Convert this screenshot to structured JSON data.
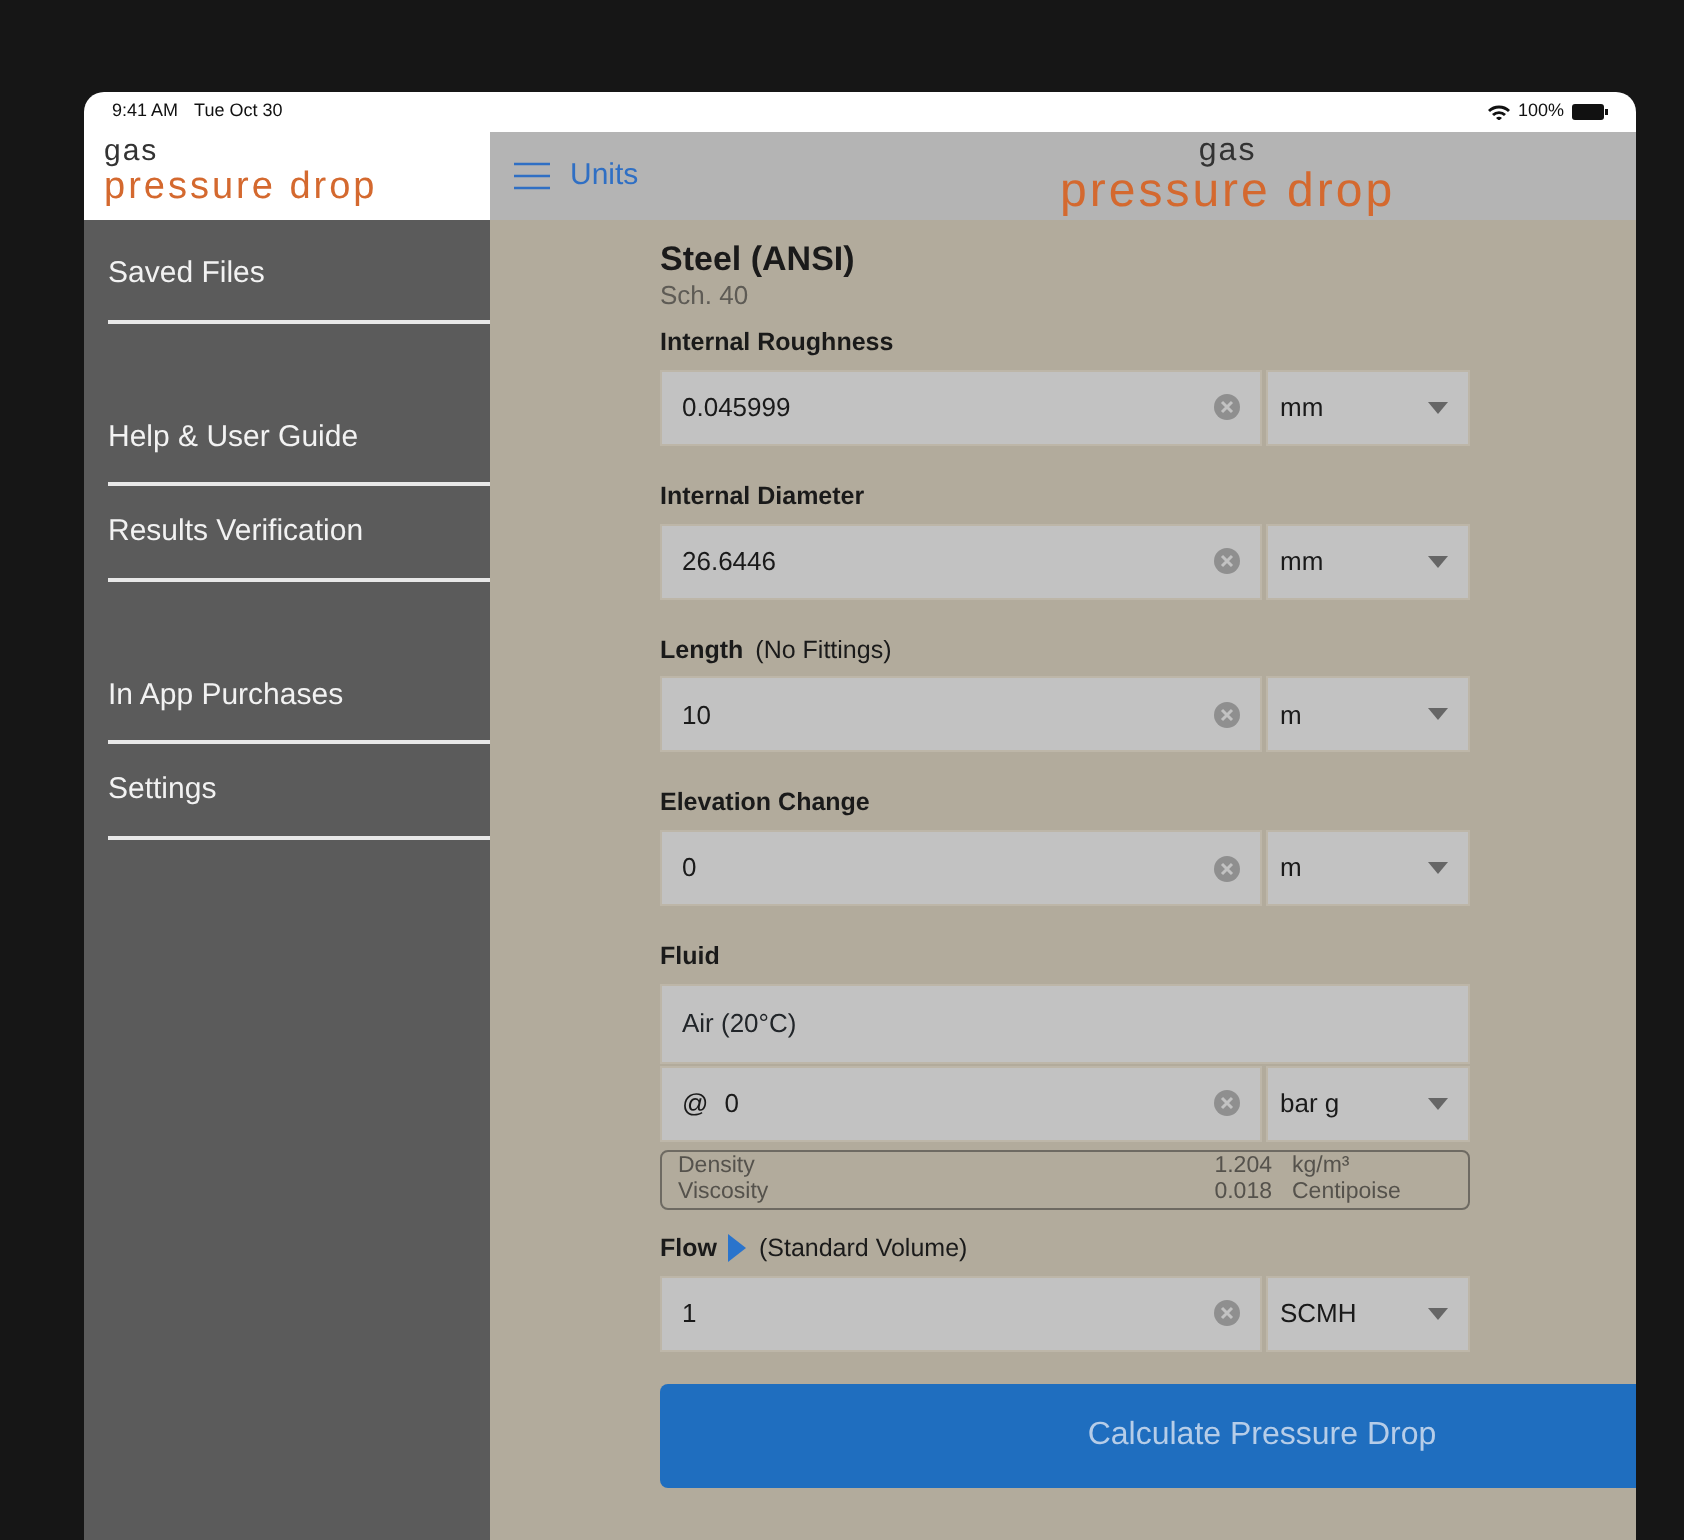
{
  "status_bar": {
    "time": "9:41 AM",
    "date": "Tue Oct 30",
    "battery": "100%"
  },
  "sidebar": {
    "logo": {
      "top": "gas",
      "bottom": "pressure drop"
    },
    "groups": [
      [
        "Saved Files"
      ],
      [
        "Help & User Guide",
        "Results Verification"
      ],
      [
        "In App Purchases",
        "Settings"
      ]
    ]
  },
  "header": {
    "menu_label": "Units",
    "logo": {
      "top": "gas",
      "bottom": "pressure drop"
    }
  },
  "form": {
    "material": {
      "title": "Steel (ANSI)",
      "schedule": "Sch.  40"
    },
    "fields": [
      {
        "kind": "measure",
        "label": "Internal Roughness",
        "value": "0.045999",
        "unit": "mm"
      },
      {
        "kind": "measure",
        "label": "Internal Diameter",
        "value": "26.6446",
        "unit": "mm"
      },
      {
        "kind": "measure",
        "label": "Length",
        "note": "(No Fittings)",
        "value": "10",
        "unit": "m"
      },
      {
        "kind": "measure",
        "label": "Elevation Change",
        "value": "0",
        "unit": "m"
      },
      {
        "kind": "fluid",
        "label": "Fluid",
        "fluid": "Air (20°C)",
        "prefix": "@",
        "value": "0",
        "unit": "bar g",
        "properties": [
          {
            "name": "Density",
            "value": "1.204",
            "unit": "kg/m³"
          },
          {
            "name": "Viscosity",
            "value": "0.018",
            "unit": "Centipoise"
          }
        ]
      },
      {
        "kind": "flow",
        "label": "Flow",
        "note": "(Standard Volume)",
        "value": "1",
        "unit": "SCMH"
      }
    ],
    "button": "Calculate Pressure Drop"
  }
}
